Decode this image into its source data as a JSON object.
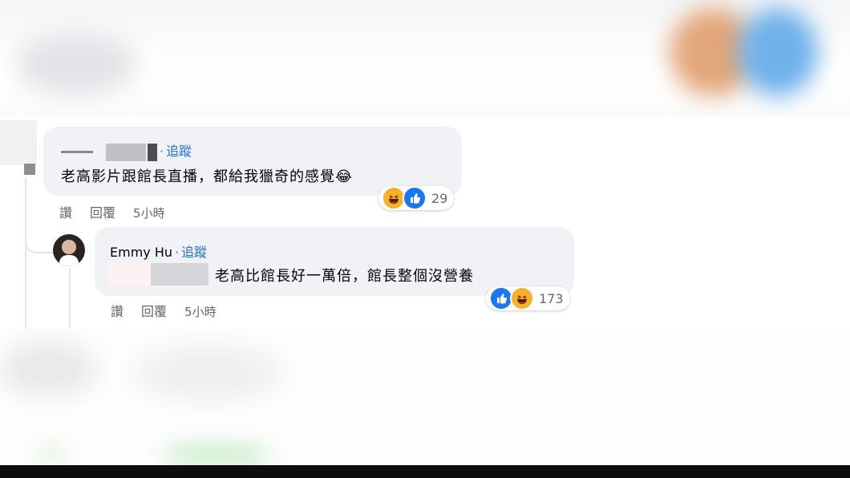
{
  "comment1": {
    "follow_label": "追蹤",
    "text": "老高影片跟館長直播，都給我獵奇的感覺😂",
    "actions": {
      "like": "讚",
      "reply": "回覆",
      "time": "5小時"
    },
    "reactions": {
      "icons": [
        "haha-icon",
        "like-icon"
      ],
      "count": "29"
    }
  },
  "comment2": {
    "author": "Emmy Hu",
    "follow_label": "追蹤",
    "text": "老高比館長好一萬倍，館長整個沒營養",
    "actions": {
      "like": "讚",
      "reply": "回覆",
      "time": "5小時"
    },
    "reactions": {
      "icons": [
        "like-icon",
        "haha-icon"
      ],
      "count": "173"
    }
  },
  "colors": {
    "bubble": "#f0f2f5",
    "link": "#216fdb",
    "meta": "#65676b",
    "like": "#1877f2",
    "haha": "#f7b125"
  }
}
